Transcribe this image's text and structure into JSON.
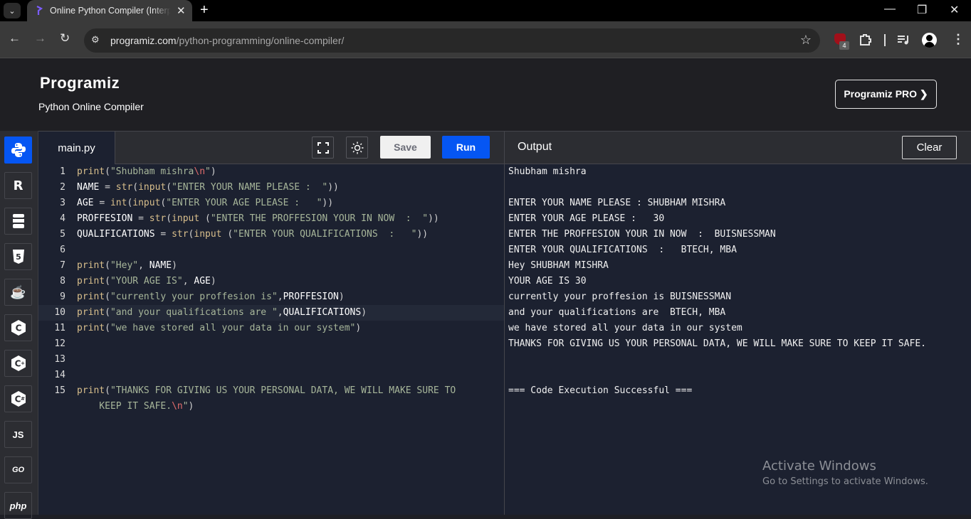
{
  "browser": {
    "tab_title": "Online Python Compiler (Interpreter)",
    "url_host": "programiz.com",
    "url_path": "/python-programming/online-compiler/",
    "extension_badge": "4",
    "icons": {
      "tab_menu": "chevron-down-icon",
      "close_tab": "close-icon",
      "new_tab": "plus-icon",
      "back": "arrow-left-icon",
      "forward": "arrow-right-icon",
      "reload": "reload-icon",
      "site_info": "tune-icon",
      "bookmark": "star-icon",
      "extensions": "puzzle-icon",
      "media": "media-queue-icon",
      "profile": "avatar-icon",
      "menu": "kebab-menu-icon"
    }
  },
  "header": {
    "logo": "Programiz",
    "subtitle": "Python Online Compiler",
    "pro_button": "Programiz PRO ❯"
  },
  "sidebar": {
    "languages": [
      {
        "name": "Python",
        "icon": "python-icon",
        "active": true
      },
      {
        "name": "R",
        "icon": "r-icon",
        "label": "R"
      },
      {
        "name": "SQL",
        "icon": "database-icon"
      },
      {
        "name": "HTML",
        "icon": "html5-icon",
        "label": "5"
      },
      {
        "name": "Java",
        "icon": "java-icon",
        "label": "☕"
      },
      {
        "name": "C",
        "icon": "c-icon",
        "label": "C"
      },
      {
        "name": "C++",
        "icon": "cpp-icon",
        "label": "C+"
      },
      {
        "name": "C#",
        "icon": "csharp-icon",
        "label": "C#"
      },
      {
        "name": "JavaScript",
        "icon": "js-icon",
        "label": "JS"
      },
      {
        "name": "Go",
        "icon": "go-icon",
        "label": "GO"
      },
      {
        "name": "PHP",
        "icon": "php-icon",
        "label": "php"
      }
    ]
  },
  "editor": {
    "filename": "main.py",
    "save_label": "Save",
    "run_label": "Run",
    "current_line": 10,
    "lines": [
      {
        "n": "1",
        "tokens": [
          [
            "fn",
            "print"
          ],
          [
            "p",
            "("
          ],
          [
            "str",
            "\"Shubham mishra"
          ],
          [
            "esc",
            "\\n"
          ],
          [
            "str",
            "\""
          ],
          [
            "p",
            ")"
          ]
        ]
      },
      {
        "n": "2",
        "tokens": [
          [
            "id",
            "NAME "
          ],
          [
            "p",
            "= "
          ],
          [
            "fn",
            "str"
          ],
          [
            "p",
            "("
          ],
          [
            "fn",
            "input"
          ],
          [
            "p",
            "("
          ],
          [
            "str",
            "\"ENTER YOUR NAME PLEASE :  \""
          ],
          [
            "p",
            "))"
          ]
        ]
      },
      {
        "n": "3",
        "tokens": [
          [
            "id",
            "AGE "
          ],
          [
            "p",
            "= "
          ],
          [
            "fn",
            "int"
          ],
          [
            "p",
            "("
          ],
          [
            "fn",
            "input"
          ],
          [
            "p",
            "("
          ],
          [
            "str",
            "\"ENTER YOUR AGE PLEASE :   \""
          ],
          [
            "p",
            "))"
          ]
        ]
      },
      {
        "n": "4",
        "tokens": [
          [
            "id",
            "PROFFESION "
          ],
          [
            "p",
            "= "
          ],
          [
            "fn",
            "str"
          ],
          [
            "p",
            "("
          ],
          [
            "fn",
            "input"
          ],
          [
            "p",
            " ("
          ],
          [
            "str",
            "\"ENTER THE PROFFESION YOUR IN NOW  :  \""
          ],
          [
            "p",
            "))"
          ]
        ]
      },
      {
        "n": "5",
        "tokens": [
          [
            "id",
            "QUALIFICATIONS "
          ],
          [
            "p",
            "= "
          ],
          [
            "fn",
            "str"
          ],
          [
            "p",
            "("
          ],
          [
            "fn",
            "input"
          ],
          [
            "p",
            " ("
          ],
          [
            "str",
            "\"ENTER YOUR QUALIFICATIONS  :   \""
          ],
          [
            "p",
            "))"
          ]
        ]
      },
      {
        "n": "6",
        "tokens": []
      },
      {
        "n": "7",
        "tokens": [
          [
            "fn",
            "print"
          ],
          [
            "p",
            "("
          ],
          [
            "str",
            "\"Hey\""
          ],
          [
            "p",
            ", "
          ],
          [
            "id",
            "NAME"
          ],
          [
            "p",
            ")"
          ]
        ]
      },
      {
        "n": "8",
        "tokens": [
          [
            "fn",
            "print"
          ],
          [
            "p",
            "("
          ],
          [
            "str",
            "\"YOUR AGE IS\""
          ],
          [
            "p",
            ", "
          ],
          [
            "id",
            "AGE"
          ],
          [
            "p",
            ")"
          ]
        ]
      },
      {
        "n": "9",
        "tokens": [
          [
            "fn",
            "print"
          ],
          [
            "p",
            "("
          ],
          [
            "str",
            "\"currently your proffesion is\""
          ],
          [
            "p",
            ","
          ],
          [
            "id",
            "PROFFESION"
          ],
          [
            "p",
            ")"
          ]
        ]
      },
      {
        "n": "10",
        "tokens": [
          [
            "fn",
            "print"
          ],
          [
            "p",
            "("
          ],
          [
            "str",
            "\"and your qualifications are \""
          ],
          [
            "p",
            ","
          ],
          [
            "id",
            "QUALIFICATIONS"
          ],
          [
            "p",
            ")"
          ]
        ]
      },
      {
        "n": "11",
        "tokens": [
          [
            "fn",
            "print"
          ],
          [
            "p",
            "("
          ],
          [
            "str",
            "\"we have stored all your data in our system\""
          ],
          [
            "p",
            ")"
          ]
        ]
      },
      {
        "n": "12",
        "tokens": []
      },
      {
        "n": "13",
        "tokens": []
      },
      {
        "n": "14",
        "tokens": []
      },
      {
        "n": "15",
        "tokens": [
          [
            "fn",
            "print"
          ],
          [
            "p",
            "("
          ],
          [
            "str",
            "\"THANKS FOR GIVING US YOUR PERSONAL DATA, WE WILL MAKE SURE TO"
          ]
        ]
      },
      {
        "n": "",
        "tokens": [
          [
            "str",
            "    KEEP IT SAFE."
          ],
          [
            "esc",
            "\\n"
          ],
          [
            "str",
            "\""
          ],
          [
            "p",
            ")"
          ]
        ]
      }
    ]
  },
  "output": {
    "title": "Output",
    "clear_label": "Clear",
    "lines": [
      "Shubham mishra",
      "",
      "ENTER YOUR NAME PLEASE : SHUBHAM MISHRA",
      "ENTER YOUR AGE PLEASE :   30",
      "ENTER THE PROFFESION YOUR IN NOW  :  BUISNESSMAN",
      "ENTER YOUR QUALIFICATIONS  :   BTECH, MBA",
      "Hey SHUBHAM MISHRA",
      "YOUR AGE IS 30",
      "currently your proffesion is BUISNESSMAN",
      "and your qualifications are  BTECH, MBA",
      "we have stored all your data in our system",
      "THANKS FOR GIVING US YOUR PERSONAL DATA, WE WILL MAKE SURE TO KEEP IT SAFE.",
      "",
      "",
      "=== Code Execution Successful ==="
    ]
  },
  "watermark": {
    "title": "Activate Windows",
    "subtitle": "Go to Settings to activate Windows."
  },
  "colors": {
    "accent": "#0556f3",
    "editor_bg": "#1c2130",
    "function": "#d9bf8c",
    "string": "#a7b69a",
    "escape": "#e06c6c"
  }
}
